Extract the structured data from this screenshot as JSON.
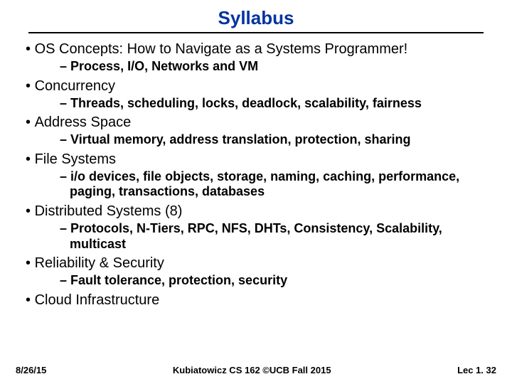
{
  "title": "Syllabus",
  "items": [
    {
      "label": "OS Concepts: How to Navigate as a Systems Programmer!",
      "sub": [
        "Process, I/O, Networks and VM"
      ]
    },
    {
      "label": "Concurrency",
      "sub": [
        "Threads, scheduling, locks, deadlock, scalability, fairness"
      ]
    },
    {
      "label": "Address Space",
      "sub": [
        "Virtual memory, address translation, protection, sharing"
      ]
    },
    {
      "label": "File Systems",
      "sub": [
        "i/o devices, file objects, storage, naming, caching, performance, paging, transactions, databases"
      ]
    },
    {
      "label": "Distributed Systems (8)",
      "sub": [
        "Protocols, N-Tiers, RPC, NFS, DHTs, Consistency, Scalability, multicast"
      ]
    },
    {
      "label": "Reliability & Security",
      "sub": [
        "Fault tolerance, protection, security"
      ]
    },
    {
      "label": "Cloud Infrastructure",
      "sub": []
    }
  ],
  "footer": {
    "left": "8/26/15",
    "center": "Kubiatowicz CS 162 ©UCB Fall 2015",
    "right": "Lec 1. 32"
  }
}
